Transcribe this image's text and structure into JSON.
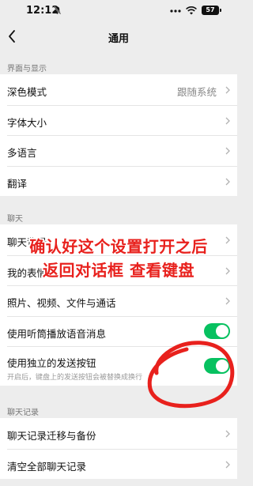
{
  "status": {
    "time": "12:12",
    "battery": "57"
  },
  "nav": {
    "title": "通用"
  },
  "sections": {
    "display": "界面与显示",
    "chat": "聊天",
    "history": "聊天记录"
  },
  "display_items": [
    {
      "label": "深色模式",
      "value": "跟随系统"
    },
    {
      "label": "字体大小"
    },
    {
      "label": "多语言"
    },
    {
      "label": "翻译"
    }
  ],
  "chat_items": [
    {
      "label": "聊天背景"
    },
    {
      "label": "我的表情"
    },
    {
      "label": "照片、视频、文件与通话"
    },
    {
      "label": "使用听筒播放语音消息",
      "toggle": true
    },
    {
      "label": "使用独立的发送按钮",
      "sub": "开启后，键盘上的发送按钮会被替换成换行",
      "toggle": true
    }
  ],
  "history_items": [
    {
      "label": "聊天记录迁移与备份"
    },
    {
      "label": "清空全部聊天记录"
    }
  ],
  "annotation": {
    "line1": "确认好这个设置打开之后",
    "line2": "返回对话框 查看键盘",
    "color": "#e8211d"
  },
  "colors": {
    "toggle_on": "#07c160",
    "background": "#ededed"
  }
}
